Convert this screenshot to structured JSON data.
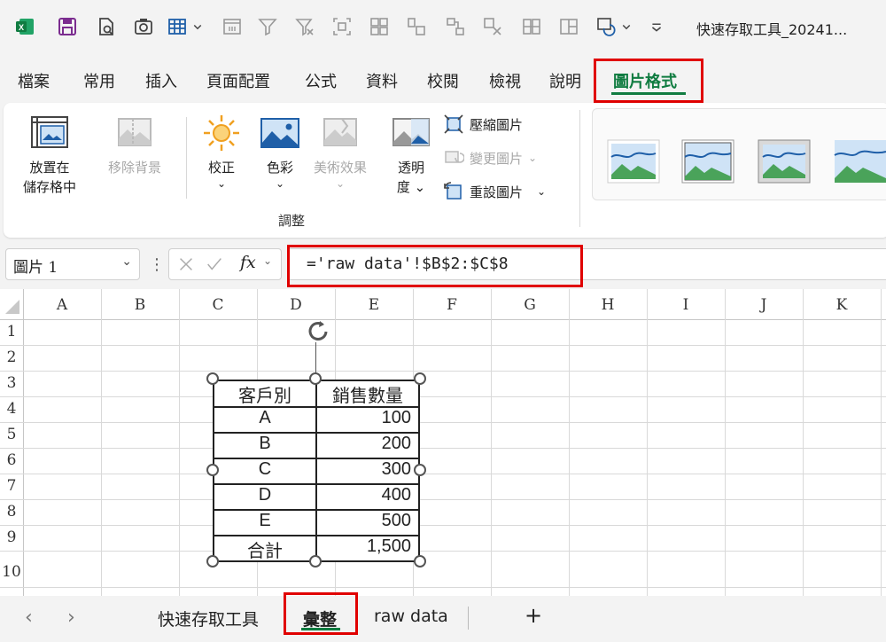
{
  "app": {
    "doc_title": "快速存取工具_20241...",
    "qat_icons": [
      "excel-logo-icon",
      "save-icon",
      "print-preview-icon",
      "camera-icon",
      "table-grid-icon",
      "dropdown-chevron-icon",
      "freeze-panes-icon",
      "filter-icon",
      "clear-filter-icon",
      "select-objects-icon",
      "group-icon",
      "align-icon",
      "connector-icon",
      "crop-icon",
      "distribute-icon",
      "split-icon",
      "bring-forward-icon",
      "dropdown-chevron-icon",
      "customize-qat-icon"
    ]
  },
  "tabs": [
    "檔案",
    "常用",
    "插入",
    "頁面配置",
    "公式",
    "資料",
    "校閱",
    "檢視",
    "說明",
    "圖片格式"
  ],
  "active_tab": "圖片格式",
  "ribbon": {
    "place_in_cell": [
      "放置在",
      "儲存格中"
    ],
    "remove_bg": "移除背景",
    "corrections": "校正",
    "color": "色彩",
    "artistic": "美術效果",
    "transparency": [
      "透明",
      "度"
    ],
    "compress": "壓縮圖片",
    "change_picture": "變更圖片",
    "reset_picture": "重設圖片",
    "group_label": "調整"
  },
  "formula_bar": {
    "name_box": "圖片 1",
    "formula": "='raw data'!$B$2:$C$8"
  },
  "grid": {
    "columns": [
      "A",
      "B",
      "C",
      "D",
      "E",
      "F",
      "G",
      "H",
      "I",
      "J",
      "K"
    ],
    "rows": [
      "1",
      "2",
      "3",
      "4",
      "5",
      "6",
      "7",
      "8",
      "9",
      "10"
    ]
  },
  "picture_table": {
    "headers": [
      "客戶別",
      "銷售數量"
    ],
    "rows": [
      [
        "A",
        "100"
      ],
      [
        "B",
        "200"
      ],
      [
        "C",
        "300"
      ],
      [
        "D",
        "400"
      ],
      [
        "E",
        "500"
      ],
      [
        "合計",
        "1,500"
      ]
    ]
  },
  "sheet_tabs": [
    "快速存取工具",
    "彙整",
    "raw data"
  ],
  "active_sheet": "彙整",
  "add_sheet": "+",
  "colors": {
    "accent": "#107c41",
    "highlight": "#e00000"
  }
}
